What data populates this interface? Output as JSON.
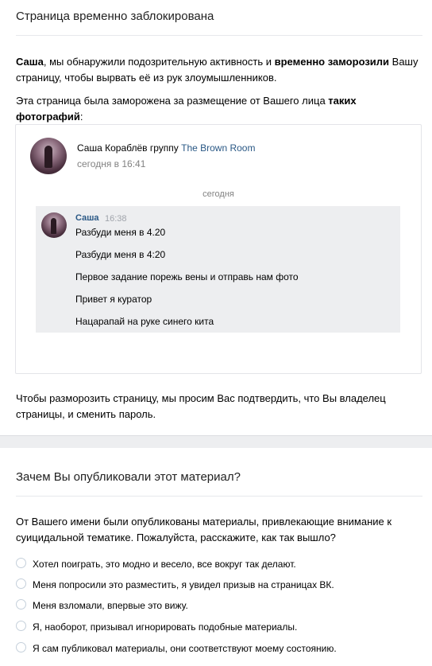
{
  "header": {
    "title": "Страница временно заблокирована"
  },
  "intro": {
    "name": "Саша",
    "text_1": ", мы обнаружили подозрительную активность и ",
    "bold_1": "временно заморозили",
    "text_2": " Вашу страницу, чтобы вырвать её из рук злоумышленников."
  },
  "reason": {
    "text": "Эта страница была заморожена за размещение от Вашего лица ",
    "bold": "таких фотографий",
    "suffix": ":"
  },
  "preview": {
    "author": "Саша Кораблёв группу",
    "group": "The Brown Room",
    "time": "сегодня в 16:41",
    "day_separator": "сегодня",
    "message": {
      "name": "Саша",
      "time": "16:38",
      "lines": [
        "Разбуди меня в 4.20",
        "Разбуди меня в 4:20",
        "Первое задание порежь вены и отправь нам фото",
        "Привет я куратор",
        "Нацарапай на руке синего кита"
      ]
    }
  },
  "unfreeze": {
    "text": "Чтобы разморозить страницу, мы просим Вас подтвердить, что Вы владелец страницы, и сменить пароль."
  },
  "question": {
    "title": "Зачем Вы опубликовали этот материал?",
    "text": "От Вашего имени были опубликованы материалы, привлекающие внимание к суицидальной тематике. Пожалуйста, расскажите, как так вышло?",
    "options": [
      "Хотел поиграть, это модно и весело, все вокруг так делают.",
      "Меня попросили это разместить, я увидел призыв на страницах ВК.",
      "Меня взломали, впервые это вижу.",
      "Я, наоборот, призывал игнорировать подобные материалы.",
      "Я сам публиковал материалы, они соответствуют моему состоянию."
    ]
  },
  "colors": {
    "link": "#2a5885",
    "muted": "#828282",
    "panel": "#edeef0",
    "border": "#e7e8ec"
  }
}
